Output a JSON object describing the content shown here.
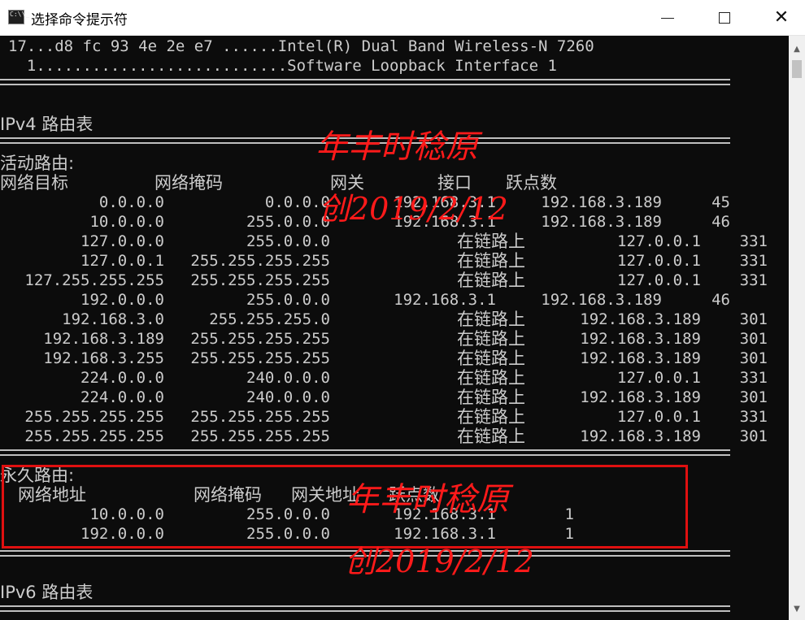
{
  "window": {
    "title": "选择命令提示符",
    "icon_text": "C:\\\\_"
  },
  "controls": {
    "minimize": "minimize-icon",
    "maximize": "maximize-icon",
    "close": "close-icon"
  },
  "interfaces": [
    "17...d8 fc 93 4e 2e e7 ......Intel(R) Dual Band Wireless-N 7260",
    "  1...........................Software Loopback Interface 1"
  ],
  "ipv4": {
    "title": "IPv4 路由表",
    "active_title": "活动路由:",
    "active_headers": [
      "网络目标",
      "网络掩码",
      "网关",
      "接口",
      "跃点数"
    ],
    "active_routes": [
      [
        "0.0.0.0",
        "0.0.0.0",
        "192.168.3.1",
        "192.168.3.189",
        "45"
      ],
      [
        "10.0.0.0",
        "255.0.0.0",
        "192.168.3.1",
        "192.168.3.189",
        "46"
      ],
      [
        "127.0.0.0",
        "255.0.0.0",
        "在链路上",
        "127.0.0.1",
        "331"
      ],
      [
        "127.0.0.1",
        "255.255.255.255",
        "在链路上",
        "127.0.0.1",
        "331"
      ],
      [
        "127.255.255.255",
        "255.255.255.255",
        "在链路上",
        "127.0.0.1",
        "331"
      ],
      [
        "192.0.0.0",
        "255.0.0.0",
        "192.168.3.1",
        "192.168.3.189",
        "46"
      ],
      [
        "192.168.3.0",
        "255.255.255.0",
        "在链路上",
        "192.168.3.189",
        "301"
      ],
      [
        "192.168.3.189",
        "255.255.255.255",
        "在链路上",
        "192.168.3.189",
        "301"
      ],
      [
        "192.168.3.255",
        "255.255.255.255",
        "在链路上",
        "192.168.3.189",
        "301"
      ],
      [
        "224.0.0.0",
        "240.0.0.0",
        "在链路上",
        "127.0.0.1",
        "331"
      ],
      [
        "224.0.0.0",
        "240.0.0.0",
        "在链路上",
        "192.168.3.189",
        "301"
      ],
      [
        "255.255.255.255",
        "255.255.255.255",
        "在链路上",
        "127.0.0.1",
        "331"
      ],
      [
        "255.255.255.255",
        "255.255.255.255",
        "在链路上",
        "192.168.3.189",
        "301"
      ]
    ],
    "persistent_title": "永久路由:",
    "persistent_headers": [
      "网络地址",
      "网络掩码",
      "网关地址",
      "跃点数"
    ],
    "persistent_routes": [
      [
        "10.0.0.0",
        "255.0.0.0",
        "192.168.3.1",
        "1"
      ],
      [
        "192.0.0.0",
        "255.0.0.0",
        "192.168.3.1",
        "1"
      ]
    ]
  },
  "ipv6": {
    "title": "IPv6 路由表"
  },
  "watermarks": {
    "line1": "年丰时稔原",
    "line2": "创2019/2/12"
  },
  "colors": {
    "console_bg": "#0c0c0c",
    "console_text": "#cccccc",
    "highlight": "#e01010",
    "watermark": "#ff1a1a"
  }
}
